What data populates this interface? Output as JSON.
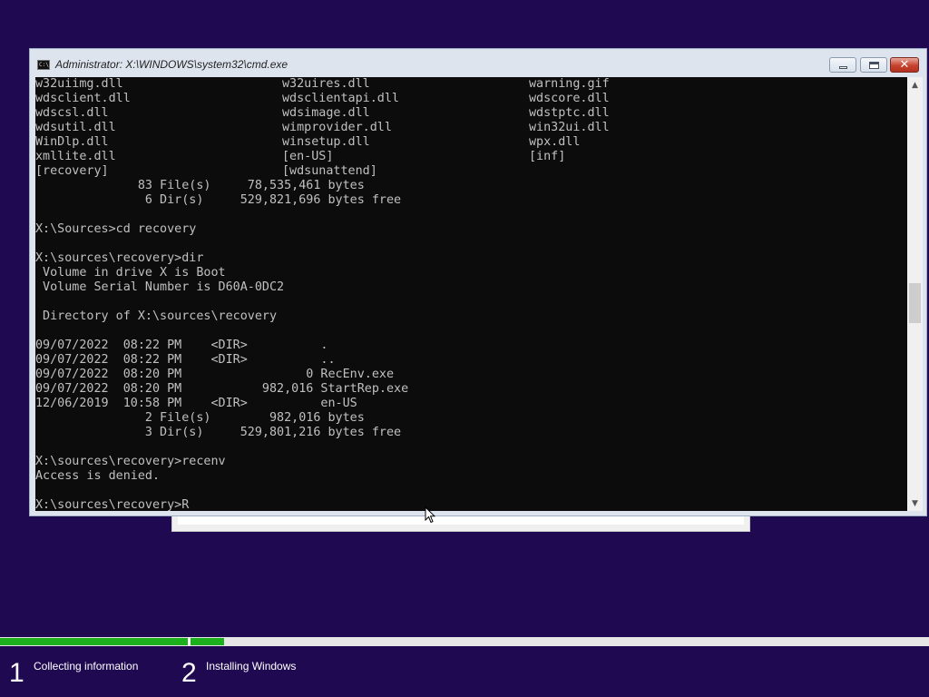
{
  "window": {
    "title": "Administrator: X:\\WINDOWS\\system32\\cmd.exe",
    "icon": "cmd-icon",
    "buttons": {
      "minimize": "minimize-icon",
      "maximize": "maximize-icon",
      "close": "✕"
    }
  },
  "console": {
    "file_rows": [
      [
        "w32uiimg.dll",
        "w32uires.dll",
        "warning.gif"
      ],
      [
        "wdsclient.dll",
        "wdsclientapi.dll",
        "wdscore.dll"
      ],
      [
        "wdscsl.dll",
        "wdsimage.dll",
        "wdstptc.dll"
      ],
      [
        "wdsutil.dll",
        "wimprovider.dll",
        "win32ui.dll"
      ],
      [
        "WinDlp.dll",
        "winsetup.dll",
        "wpx.dll"
      ],
      [
        "xmllite.dll",
        "[en-US]",
        "[inf]"
      ],
      [
        "[recovery]",
        "[wdsunattend]",
        ""
      ]
    ],
    "lines": [
      "              83 File(s)     78,535,461 bytes",
      "               6 Dir(s)     529,821,696 bytes free",
      "",
      "X:\\Sources>cd recovery",
      "",
      "X:\\sources\\recovery>dir",
      " Volume in drive X is Boot",
      " Volume Serial Number is D60A-0DC2",
      "",
      " Directory of X:\\sources\\recovery",
      "",
      "09/07/2022  08:22 PM    <DIR>          .",
      "09/07/2022  08:22 PM    <DIR>          ..",
      "09/07/2022  08:20 PM                 0 RecEnv.exe",
      "09/07/2022  08:20 PM           982,016 StartRep.exe",
      "12/06/2019  10:58 PM    <DIR>          en-US",
      "               2 File(s)        982,016 bytes",
      "               3 Dir(s)     529,801,216 bytes free",
      "",
      "X:\\sources\\recovery>recenv",
      "Access is denied.",
      "",
      "X:\\sources\\recovery>R"
    ]
  },
  "scrollbar": {
    "up": "▲",
    "down": "▼"
  },
  "setup": {
    "steps": [
      {
        "number": "1",
        "label": "Collecting information"
      },
      {
        "number": "2",
        "label": "Installing Windows"
      }
    ],
    "progress": {
      "step1_fraction": 1.0,
      "step2_fraction": 0.045
    }
  }
}
